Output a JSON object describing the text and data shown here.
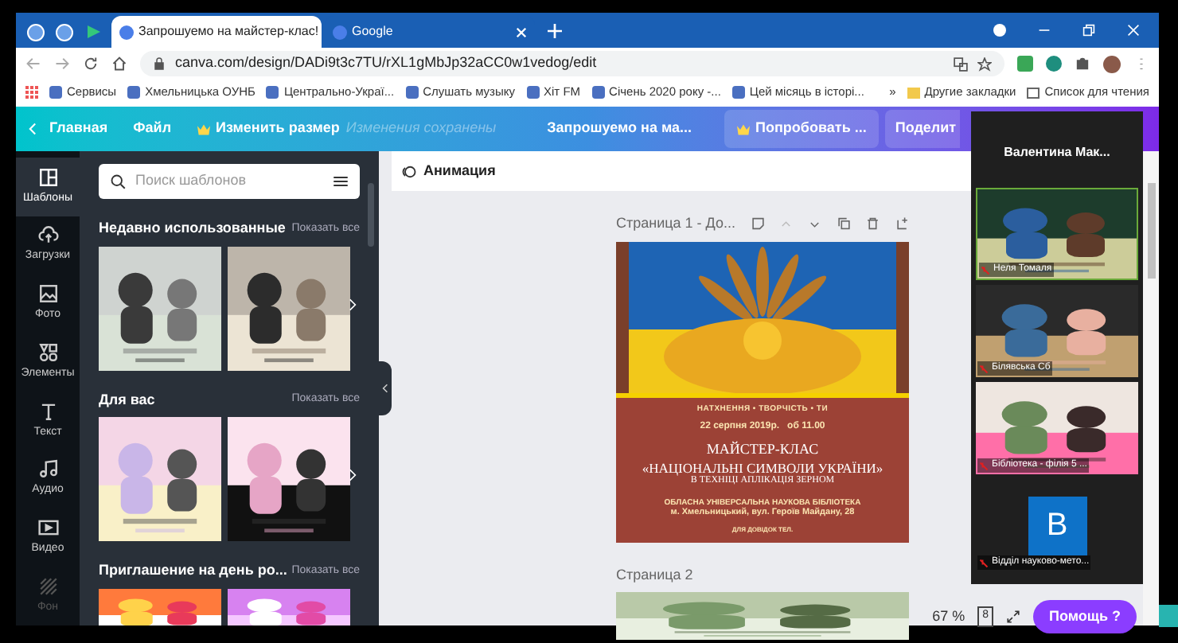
{
  "browser": {
    "tabs": [
      {
        "title": "Запрошуемо на майстер-клас!",
        "selected": true
      },
      {
        "title": "Google",
        "selected": false
      }
    ],
    "address": "canva.com/design/DADi9t3c7TU/rXL1gMbJp32aCC0w1vedog/edit",
    "bookmarks": [
      "Сервисы",
      "Хмельницька ОУНБ",
      "Центрально-Украї...",
      "Слушать музыку",
      "Хіт FM",
      "Січень 2020 року -...",
      "Цей місяць в історі..."
    ],
    "more_bookmarks": "»",
    "other_bookmarks": "Другие закладки",
    "reading_list": "Список для чтения"
  },
  "header": {
    "home": "Главная",
    "file": "Файл",
    "resize": "Изменить размер",
    "status": "Изменения сохранены",
    "design_title": "Запрошуемо на ма...",
    "try_button": "Попробовать ...",
    "share_button": "Поделит"
  },
  "rail": [
    {
      "label": "Шаблоны",
      "selected": true
    },
    {
      "label": "Загрузки",
      "selected": false
    },
    {
      "label": "Фото",
      "selected": false
    },
    {
      "label": "Элементы",
      "selected": false
    },
    {
      "label": "Текст",
      "selected": false
    },
    {
      "label": "Аудио",
      "selected": false
    },
    {
      "label": "Видео",
      "selected": false
    },
    {
      "label": "Фон",
      "selected": false
    }
  ],
  "search": {
    "placeholder": "Поиск шаблонов"
  },
  "sections": [
    {
      "title": "Недавно использованные",
      "link": "Показать все"
    },
    {
      "title": "Для вас",
      "link": "Показать все"
    },
    {
      "title": "Приглашение на день ро...",
      "link": "Показать все"
    }
  ],
  "toolbar": {
    "animation": "Анимация"
  },
  "pages": [
    {
      "label": "Страница 1 - До..."
    },
    {
      "label": "Страница 2"
    }
  ],
  "poster": {
    "motto": "НАТХНЕННЯ • ТВОРЧІСТЬ • ТИ",
    "date": "22 серпня 2019р.   об 11.00",
    "title": "МАЙСТЕР-КЛАС",
    "subtitle": "«НАЦІОНАЛЬНІ СИМВОЛИ УКРАЇНИ»",
    "technique": "В ТЕХНІЦІ АПЛІКАЦІЯ ЗЕРНОМ",
    "library": "ОБЛАСНА УНІВЕРСАЛЬНА НАУКОВА БІБЛІОТЕКА",
    "address": "м. Хмельницький, вул. Героїв Майдану, 28",
    "phone": "ДЛЯ ДОВІДОК ТЕЛ."
  },
  "zoom_level": "67 %",
  "page_count": "8",
  "help": "Помощь ?",
  "meeting": {
    "host": "Валентина Мак...",
    "participants": [
      {
        "name": "Неля Томаля",
        "kind": "video",
        "muted": true,
        "active": true
      },
      {
        "name": "Білявська Сб",
        "kind": "video",
        "muted": true,
        "active": false
      },
      {
        "name": "Бібліотека - філія 5 ...",
        "kind": "video",
        "muted": true,
        "active": false
      },
      {
        "name": "Відділ науково-мето...",
        "kind": "avatar",
        "initial": "B",
        "muted": true,
        "active": false
      }
    ]
  }
}
